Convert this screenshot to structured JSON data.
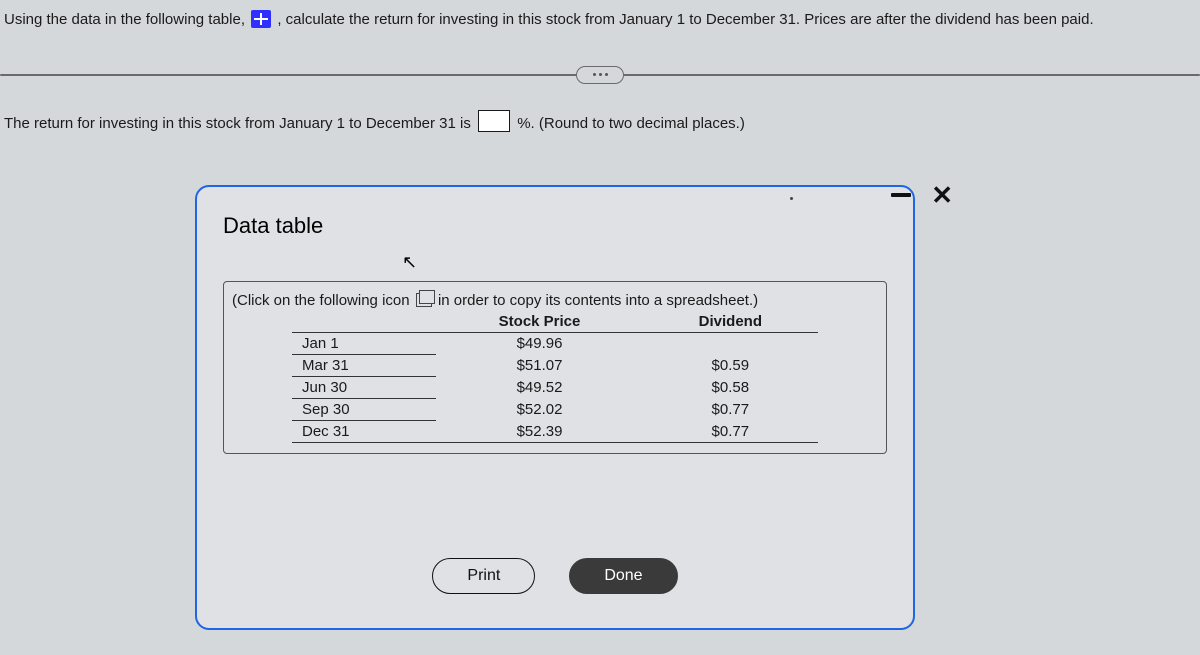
{
  "question": {
    "part1": "Using the data in the following table,",
    "part2": ", calculate the return for investing in this stock from January 1 to December 31. Prices are after the dividend has been paid."
  },
  "answer_line": {
    "pre": "The return for investing in this stock from January 1 to December 31 is",
    "unit": "%. (Round to two decimal places.)"
  },
  "modal": {
    "title": "Data table",
    "hint_pre": "(Click on the following icon",
    "hint_post": "in order to copy its contents into a spreadsheet.)",
    "table": {
      "headers": {
        "date": "",
        "price": "Stock Price",
        "dividend": "Dividend"
      },
      "rows": [
        {
          "date": "Jan 1",
          "price": "$49.96",
          "dividend": ""
        },
        {
          "date": "Mar 31",
          "price": "$51.07",
          "dividend": "$0.59"
        },
        {
          "date": "Jun 30",
          "price": "$49.52",
          "dividend": "$0.58"
        },
        {
          "date": "Sep 30",
          "price": "$52.02",
          "dividend": "$0.77"
        },
        {
          "date": "Dec 31",
          "price": "$52.39",
          "dividend": "$0.77"
        }
      ]
    },
    "buttons": {
      "print": "Print",
      "done": "Done"
    }
  }
}
